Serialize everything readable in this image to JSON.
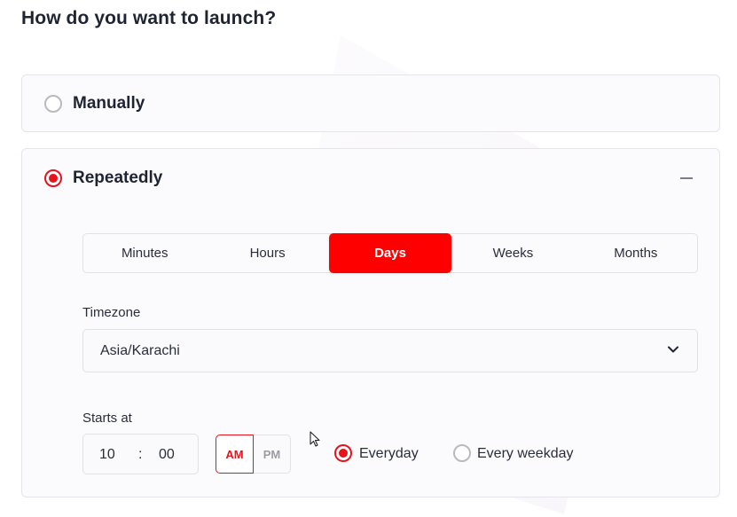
{
  "heading": "How do you want to launch?",
  "options": {
    "manual": {
      "label": "Manually",
      "selected": false
    },
    "repeat": {
      "label": "Repeatedly",
      "selected": true
    }
  },
  "tabs": [
    {
      "label": "Minutes",
      "active": false
    },
    {
      "label": "Hours",
      "active": false
    },
    {
      "label": "Days",
      "active": true
    },
    {
      "label": "Weeks",
      "active": false
    },
    {
      "label": "Months",
      "active": false
    }
  ],
  "timezone": {
    "label": "Timezone",
    "value": "Asia/Karachi"
  },
  "starts_at": {
    "label": "Starts at",
    "hour": "10",
    "separator": ":",
    "minute": "00",
    "am": "AM",
    "pm": "PM",
    "selected_period": "AM"
  },
  "frequency": {
    "everyday": {
      "label": "Everyday",
      "selected": true
    },
    "weekday": {
      "label": "Every weekday",
      "selected": false
    }
  },
  "colors": {
    "accent": "#e8121c",
    "active_tab": "#ff0000",
    "card_bg": "#fbfafc",
    "border": "#e6e4ea"
  }
}
